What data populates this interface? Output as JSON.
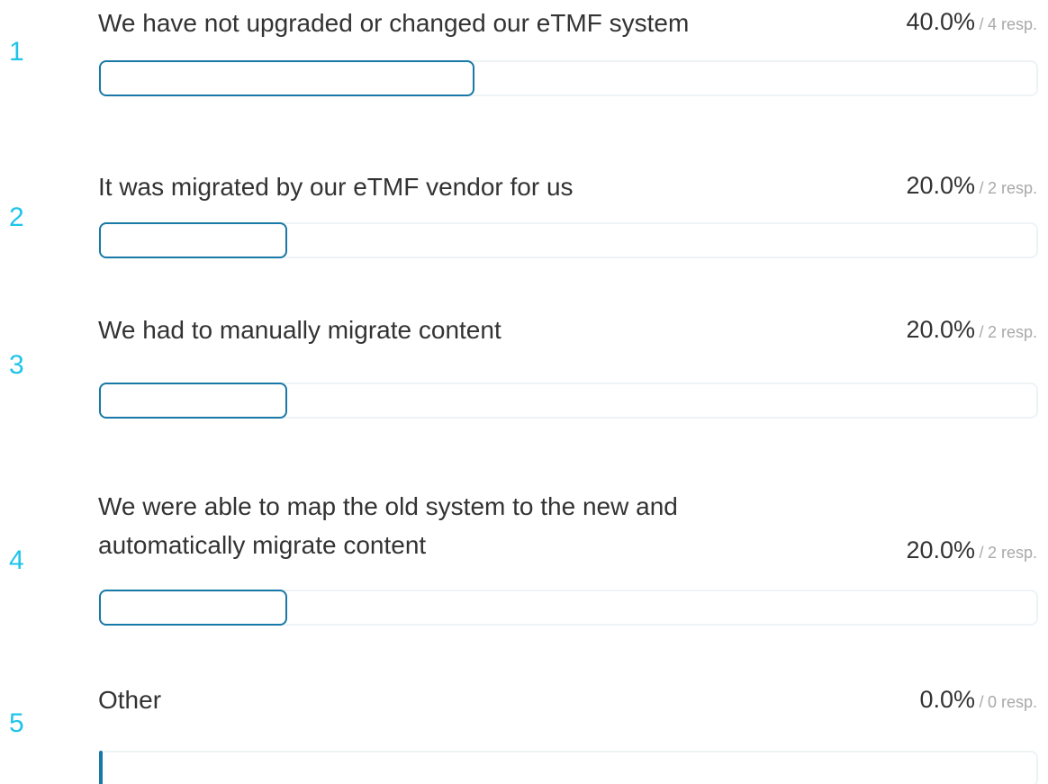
{
  "chart_data": {
    "type": "bar",
    "orientation": "horizontal",
    "categories": [
      "We have not upgraded or changed our eTMF system",
      "It was migrated by our eTMF vendor for us",
      "We had to manually migrate content",
      "We were able to map the old system to the new and automatically migrate content",
      "Other"
    ],
    "values": [
      40.0,
      20.0,
      20.0,
      20.0,
      0.0
    ],
    "ylim": [
      0,
      100
    ],
    "accent_color": "#1878a6",
    "rank_color": "#1ec4ea"
  },
  "items": [
    {
      "rank": "1",
      "label": "We have not upgraded or changed our eTMF system",
      "percent_label": "40.0%",
      "responses_label": "4 resp.",
      "percent": 40.0
    },
    {
      "rank": "2",
      "label": "It was migrated by our eTMF vendor for us",
      "percent_label": "20.0%",
      "responses_label": "2 resp.",
      "percent": 20.0
    },
    {
      "rank": "3",
      "label": "We had to manually migrate content",
      "percent_label": "20.0%",
      "responses_label": "2 resp.",
      "percent": 20.0
    },
    {
      "rank": "4",
      "label": "We were able to map the old system to the new and automatically migrate content",
      "percent_label": "20.0%",
      "responses_label": "2 resp.",
      "percent": 20.0
    },
    {
      "rank": "5",
      "label": "Other",
      "percent_label": "0.0%",
      "responses_label": "0 resp.",
      "percent": 0.0
    }
  ]
}
